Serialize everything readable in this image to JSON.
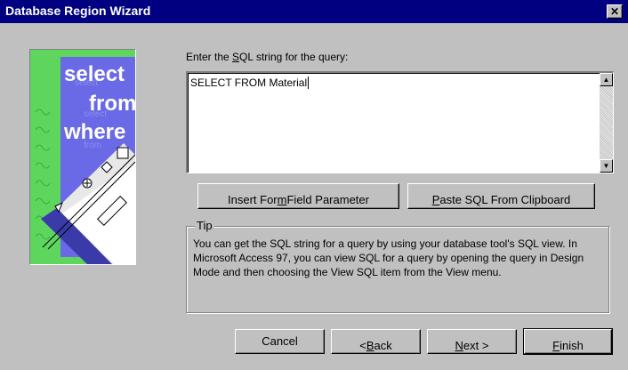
{
  "window": {
    "title": "Database Region Wizard",
    "close_glyph": "✕"
  },
  "prompt": {
    "prefix": "Enter the ",
    "underlined": "S",
    "suffix": "QL string for the query:"
  },
  "sql": {
    "value": "SELECT FROM Material"
  },
  "scrollbar": {
    "up_glyph": "▲",
    "down_glyph": "▼"
  },
  "illustration": {
    "words": [
      "select",
      "from",
      "where"
    ]
  },
  "buttons": {
    "insert": {
      "prefix": "Insert For",
      "underlined": "m",
      "suffix": " Field Parameter"
    },
    "paste": {
      "prefix": "",
      "underlined": "P",
      "suffix": "aste SQL From Clipboard"
    },
    "cancel": {
      "label": "Cancel"
    },
    "back": {
      "prefix": "< ",
      "underlined": "B",
      "suffix": "ack"
    },
    "next": {
      "prefix": "",
      "underlined": "N",
      "suffix": "ext >"
    },
    "finish": {
      "prefix": "",
      "underlined": "F",
      "suffix": "inish"
    }
  },
  "tip": {
    "legend": "Tip",
    "text": "You can get the SQL string for a query by using your database tool's SQL view.  In Microsoft Access 97, you can view SQL for a query by opening the query in Design Mode and then choosing the View SQL item from the View menu."
  }
}
